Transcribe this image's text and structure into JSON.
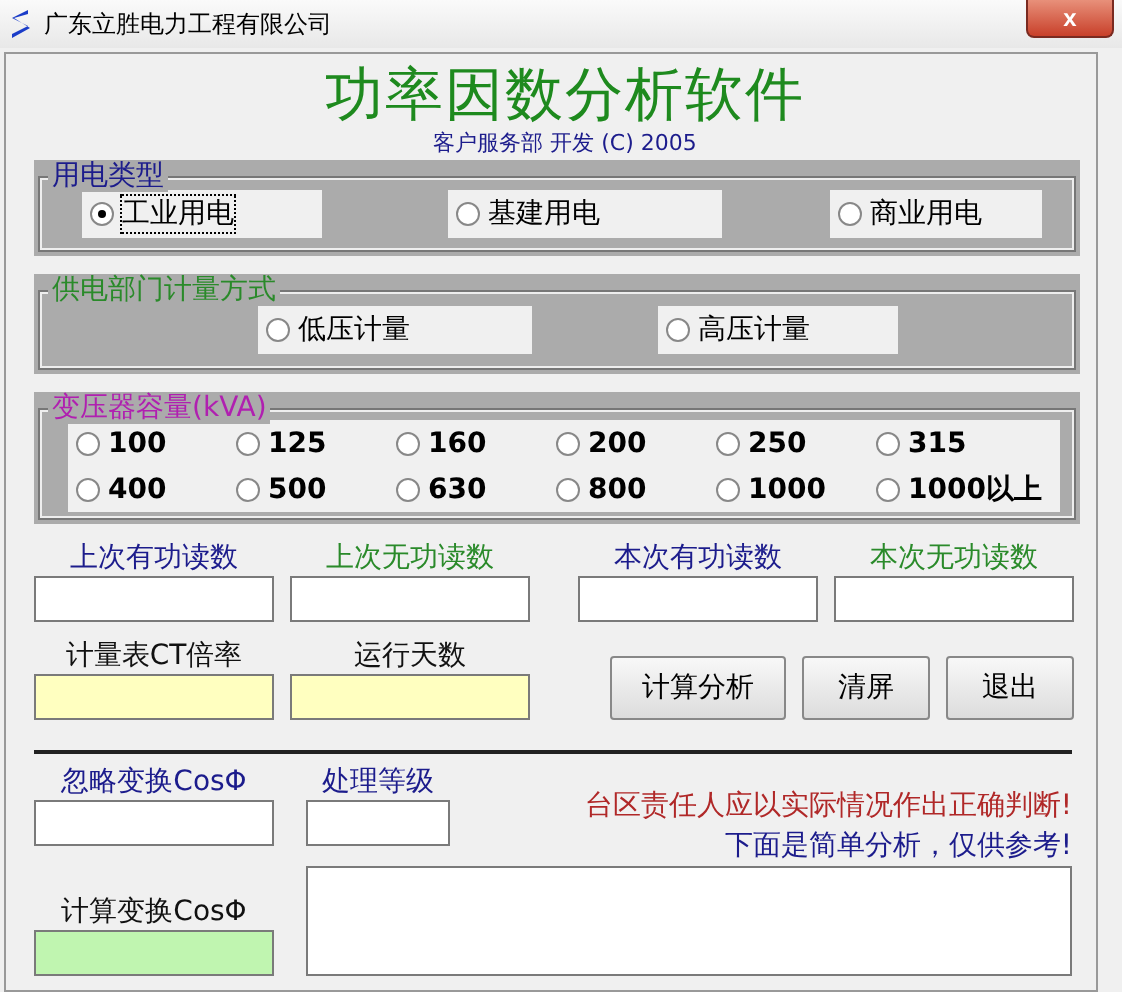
{
  "window": {
    "title": "广东立胜电力工程有限公司",
    "close": "x"
  },
  "header": {
    "title": "功率因数分析软件",
    "subtitle": "客户服务部 开发 (C) 2005"
  },
  "usage": {
    "legend": "用电类型",
    "options": [
      {
        "label": "工业用电",
        "selected": true
      },
      {
        "label": "基建用电",
        "selected": false
      },
      {
        "label": "商业用电",
        "selected": false
      }
    ]
  },
  "metering": {
    "legend": "供电部门计量方式",
    "options": [
      {
        "label": "低压计量",
        "selected": false
      },
      {
        "label": "高压计量",
        "selected": false
      }
    ]
  },
  "capacity": {
    "legend": "变压器容量(kVA)",
    "options": [
      {
        "label": "100",
        "selected": false
      },
      {
        "label": "125",
        "selected": false
      },
      {
        "label": "160",
        "selected": false
      },
      {
        "label": "200",
        "selected": false
      },
      {
        "label": "250",
        "selected": false
      },
      {
        "label": "315",
        "selected": false
      },
      {
        "label": "400",
        "selected": false
      },
      {
        "label": "500",
        "selected": false
      },
      {
        "label": "630",
        "selected": false
      },
      {
        "label": "800",
        "selected": false
      },
      {
        "label": "1000",
        "selected": false
      },
      {
        "label": "1000以上",
        "selected": false
      }
    ]
  },
  "readings": [
    {
      "label": "上次有功读数",
      "color": "#1c1c8c"
    },
    {
      "label": "上次无功读数",
      "color": "#2a8a2a"
    },
    {
      "label": "本次有功读数",
      "color": "#1c1c8c"
    },
    {
      "label": "本次无功读数",
      "color": "#2a8a2a"
    }
  ],
  "factors": [
    {
      "label": "计量表CT倍率"
    },
    {
      "label": "运行天数"
    }
  ],
  "buttons": [
    "计算分析",
    "清屏",
    "退出"
  ],
  "ignore_loss": {
    "label": "忽略变换CosΦ"
  },
  "level": {
    "label": "处理等级"
  },
  "warning": "台区责任人应以实际情况作出正确判断!",
  "note": "下面是简单分析，仅供参考!",
  "calc_loss": {
    "label": "计算变换CosΦ"
  }
}
